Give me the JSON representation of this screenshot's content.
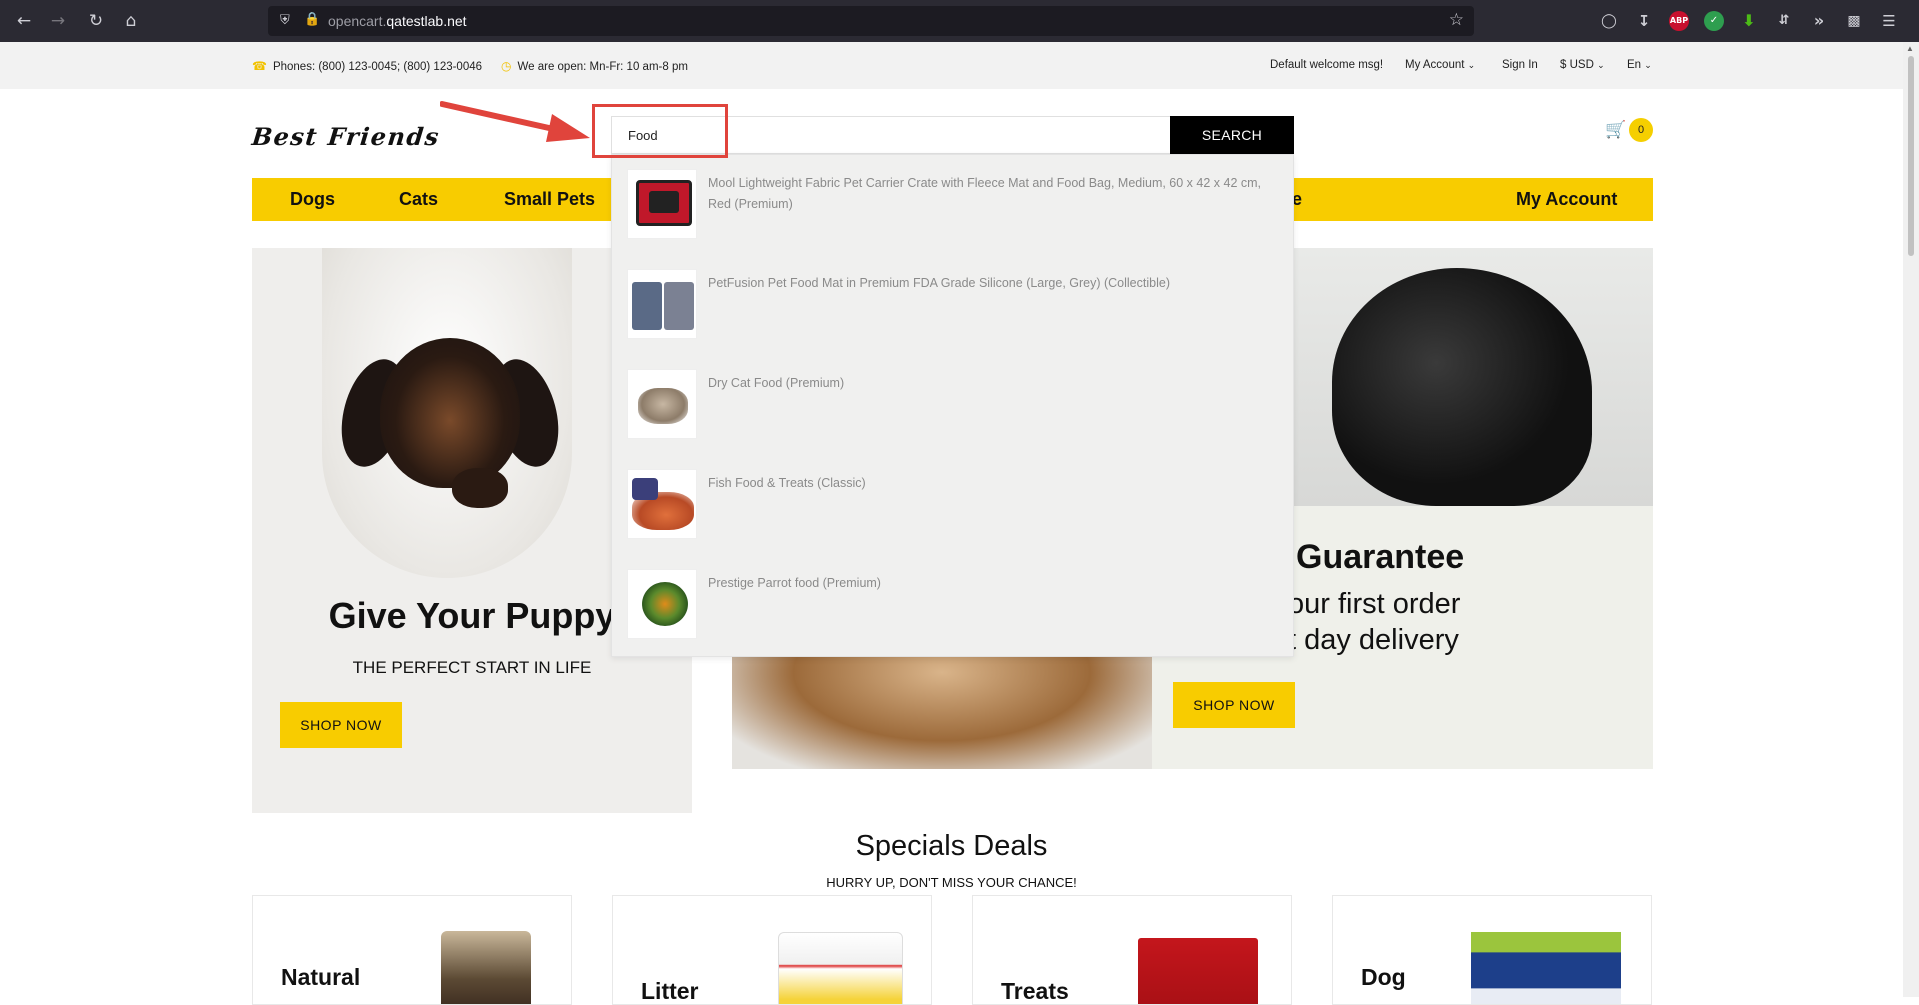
{
  "browser": {
    "url_prefix": "opencart.",
    "url_domain": "qatestlab.net"
  },
  "topbar": {
    "phones": "Phones: (800) 123-0045; (800) 123-0046",
    "hours": "We are open: Mn-Fr: 10 am-8 pm",
    "welcome": "Default welcome msg!",
    "my_account": "My Account",
    "sign_in": "Sign In",
    "currency": "$ USD",
    "language": "En"
  },
  "header": {
    "logo": "Best Friends",
    "search_value": "Food",
    "search_button": "SEARCH",
    "cart_count": "0"
  },
  "nav": {
    "items": [
      "Dogs",
      "Cats",
      "Small Pets",
      "Sale",
      "My Account"
    ]
  },
  "suggestions": [
    {
      "name": "Mool Lightweight Fabric Pet Carrier Crate with Fleece Mat and Food Bag, Medium, 60 x 42 x 42 cm, Red (Premium)"
    },
    {
      "name": "PetFusion Pet Food Mat in Premium FDA Grade Silicone (Large, Grey) (Collectible)"
    },
    {
      "name": "Dry Cat Food (Premium)"
    },
    {
      "name": "Fish Food & Treats (Classic)"
    },
    {
      "name": "Prestige Parrot food (Premium)"
    }
  ],
  "banner_left": {
    "title": "Give Your Puppy",
    "subtitle": "THE PERFECT START IN LIFE",
    "button": "SHOP NOW"
  },
  "banner_right": {
    "line1": "Guarantee",
    "line2": "our first order",
    "line3": "t day delivery",
    "button": "SHOP NOW"
  },
  "specials": {
    "title": "Specials Deals",
    "subtitle": "HURRY UP, DON'T MISS YOUR CHANCE!",
    "cards": [
      "Natural",
      "Litter",
      "Treats",
      "Dog"
    ]
  },
  "colors": {
    "accent": "#f8cc00",
    "annotation": "#e0443c"
  }
}
